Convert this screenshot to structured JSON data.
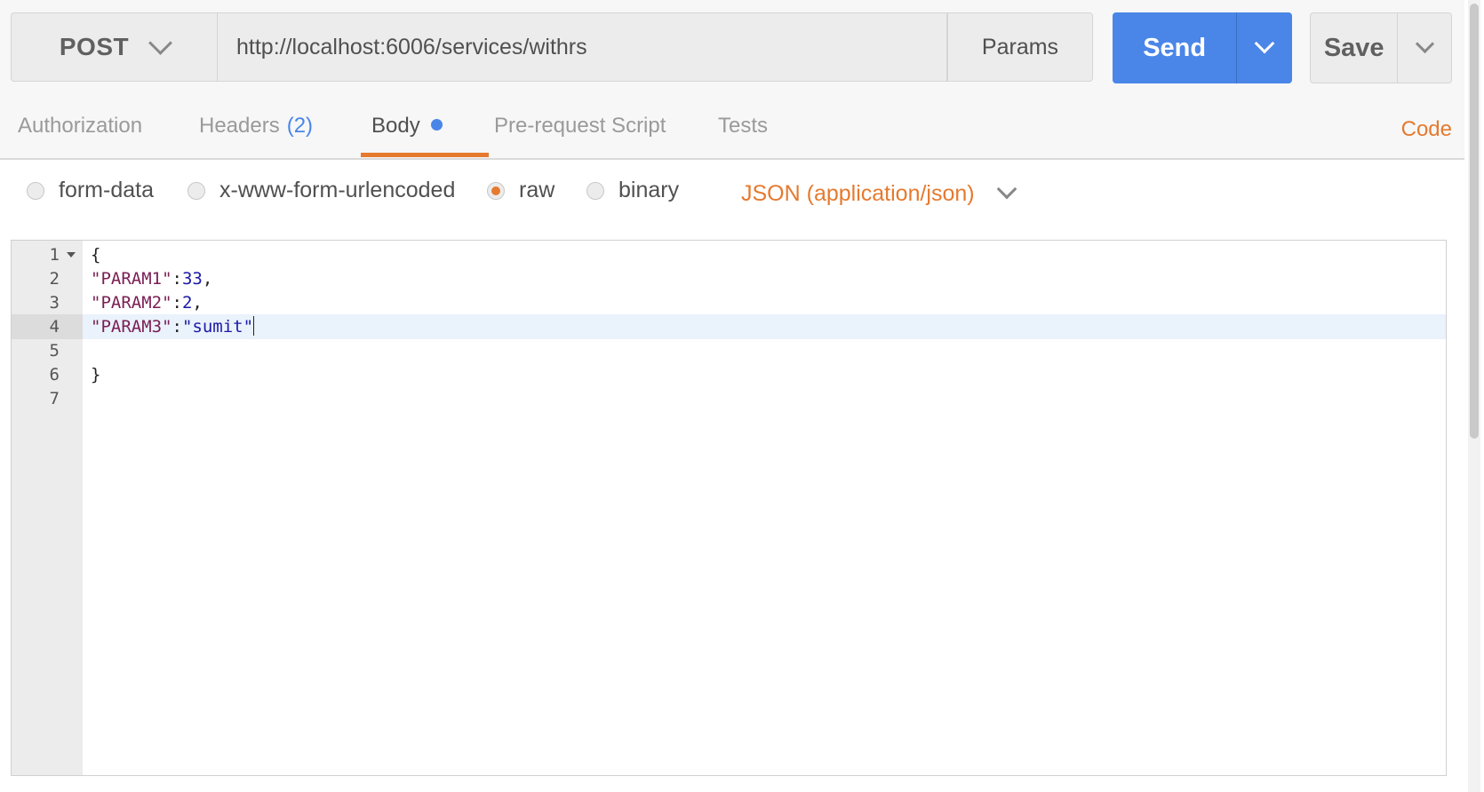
{
  "request": {
    "method": "POST",
    "url": "http://localhost:6006/services/withrs",
    "params_label": "Params",
    "send_label": "Send",
    "save_label": "Save"
  },
  "tabs": [
    {
      "label": "Authorization"
    },
    {
      "label": "Headers",
      "count": "(2)"
    },
    {
      "label": "Body",
      "active": true
    },
    {
      "label": "Pre-request Script"
    },
    {
      "label": "Tests"
    }
  ],
  "code_label": "Code",
  "body_types": [
    {
      "label": "form-data",
      "selected": false
    },
    {
      "label": "x-www-form-urlencoded",
      "selected": false
    },
    {
      "label": "raw",
      "selected": true
    },
    {
      "label": "binary",
      "selected": false
    }
  ],
  "content_type": "JSON (application/json)",
  "editor": {
    "active_line": 4,
    "lines": [
      {
        "number": "1",
        "text": "{"
      },
      {
        "number": "2",
        "key": "\"PARAM1\"",
        "sep": ":",
        "value": "33",
        "end": ","
      },
      {
        "number": "3",
        "key": "\"PARAM2\"",
        "sep": ":",
        "value": "2",
        "end": ","
      },
      {
        "number": "4",
        "key": "\"PARAM3\"",
        "sep": ":",
        "value": "\"sumit\"",
        "end": ""
      },
      {
        "number": "5",
        "text": ""
      },
      {
        "number": "6",
        "text": "}"
      },
      {
        "number": "7",
        "text": ""
      }
    ]
  },
  "colors": {
    "accent_blue": "#4a86e8",
    "accent_orange": "#e57a2f"
  }
}
